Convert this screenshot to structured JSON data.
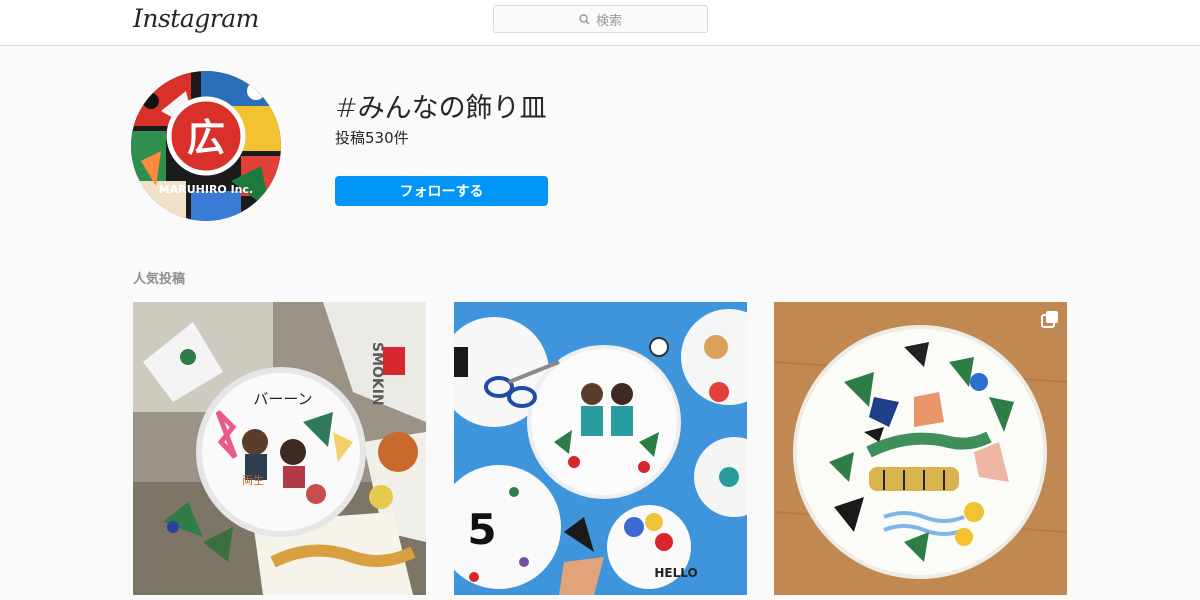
{
  "header": {
    "logo_text": "Instagram",
    "search_placeholder": "検索",
    "search_icon": "search-icon"
  },
  "profile": {
    "avatar_text": "MARUHIRO Inc.",
    "avatar_mark": "広",
    "hashtag": "#みんなの飾り皿",
    "post_count": "投稿530件",
    "follow_label": "フォローする"
  },
  "top_posts": {
    "heading": "人気投稿",
    "posts": [
      {
        "desc": "plate-with-stickers",
        "plate_text": "バーーン",
        "sticker_text": "SMOKIN",
        "sticker_text2": "両生"
      },
      {
        "desc": "plates-on-blue",
        "sticker_text": "HELLO",
        "sticker_text2": "5"
      },
      {
        "desc": "plate-on-wood",
        "multi_icon": "carousel-icon"
      }
    ]
  },
  "colors": {
    "accent": "#0095f6",
    "background": "#fafafa",
    "border": "#dbdbdb",
    "muted_text": "#8e8e8e"
  }
}
